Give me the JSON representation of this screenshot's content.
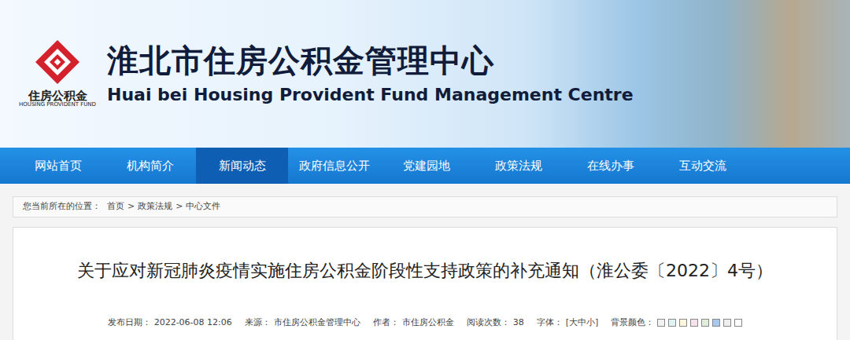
{
  "header": {
    "logo_caption": "住房公积金",
    "logo_english": "HOUSING PROVIDENT FUND",
    "title": "淮北市住房公积金管理中心",
    "english_title": "Huai bei Housing Provident Fund Management Centre"
  },
  "nav": [
    {
      "label": "网站首页",
      "selected": false
    },
    {
      "label": "机构简介",
      "selected": false
    },
    {
      "label": "新闻动态",
      "selected": true
    },
    {
      "label": "政府信息公开",
      "selected": false
    },
    {
      "label": "党建园地",
      "selected": false
    },
    {
      "label": "政策法规",
      "selected": false
    },
    {
      "label": "在线办事",
      "selected": false
    },
    {
      "label": "互动交流",
      "selected": false
    }
  ],
  "breadcrumb": {
    "label": "您当前所在的位置：",
    "separator": ">",
    "items": [
      "首页",
      "政策法规",
      "中心文件"
    ]
  },
  "article": {
    "title": "关于应对新冠肺炎疫情实施住房公积金阶段性支持政策的补充通知（淮公委〔2022〕4号）",
    "meta": [
      {
        "label": "发布日期：",
        "value": "2022-06-08 12:06"
      },
      {
        "label": "来源：",
        "value": "市住房公积金管理中心"
      },
      {
        "label": "作者：",
        "value": "市住房公积金"
      },
      {
        "label": "阅读次数：",
        "value": "38"
      },
      {
        "label": "字体：",
        "value": "[大中小]"
      }
    ],
    "background_label": "背景颜色：",
    "swatches": [
      {
        "color": "#f2f2f2"
      },
      {
        "color": "#dff3f3"
      },
      {
        "color": "#fbf6dc"
      },
      {
        "color": "#f6e2ea"
      },
      {
        "color": "#e2eedc"
      },
      {
        "color": "#a9c8ee"
      },
      {
        "color": "#eeeeee"
      },
      {
        "color": "#ffffff"
      }
    ]
  }
}
